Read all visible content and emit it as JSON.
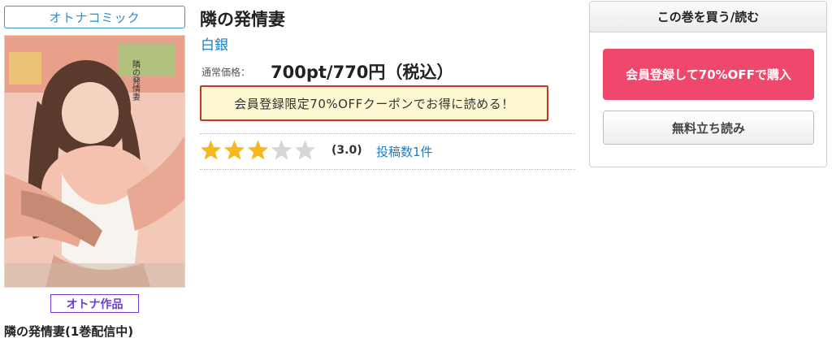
{
  "book": {
    "category_tag": "オトナコミック",
    "cover_title": "隣の発情妻",
    "adult_badge": "オトナ作品",
    "series_title": "隣の発情妻(1巻配信中)",
    "title": "隣の発情妻",
    "author": "白銀",
    "price_label": "通常価格：",
    "price": "700pt/770円（税込）",
    "coupon_text": "会員登録限定70%OFFクーポンでお得に読める！",
    "rating": {
      "value": 3.0,
      "max": 5,
      "display": "(3.0)",
      "review_link": "投稿数1件"
    }
  },
  "buy_panel": {
    "header": "この巻を買う/読む",
    "member_button": "会員登録して70%OFFで購入",
    "preview_button": "無料立ち読み"
  },
  "colors": {
    "accent_blue": "#1e7fc6",
    "badge_purple": "#6a3fd1",
    "buy_pink": "#f0476d",
    "coupon_bg": "#fdf7d2",
    "coupon_border": "#c0392b",
    "star_filled": "#f5b81e",
    "star_empty": "#d6d6d6"
  },
  "icons": [
    "star-filled-icon",
    "star-empty-icon"
  ]
}
